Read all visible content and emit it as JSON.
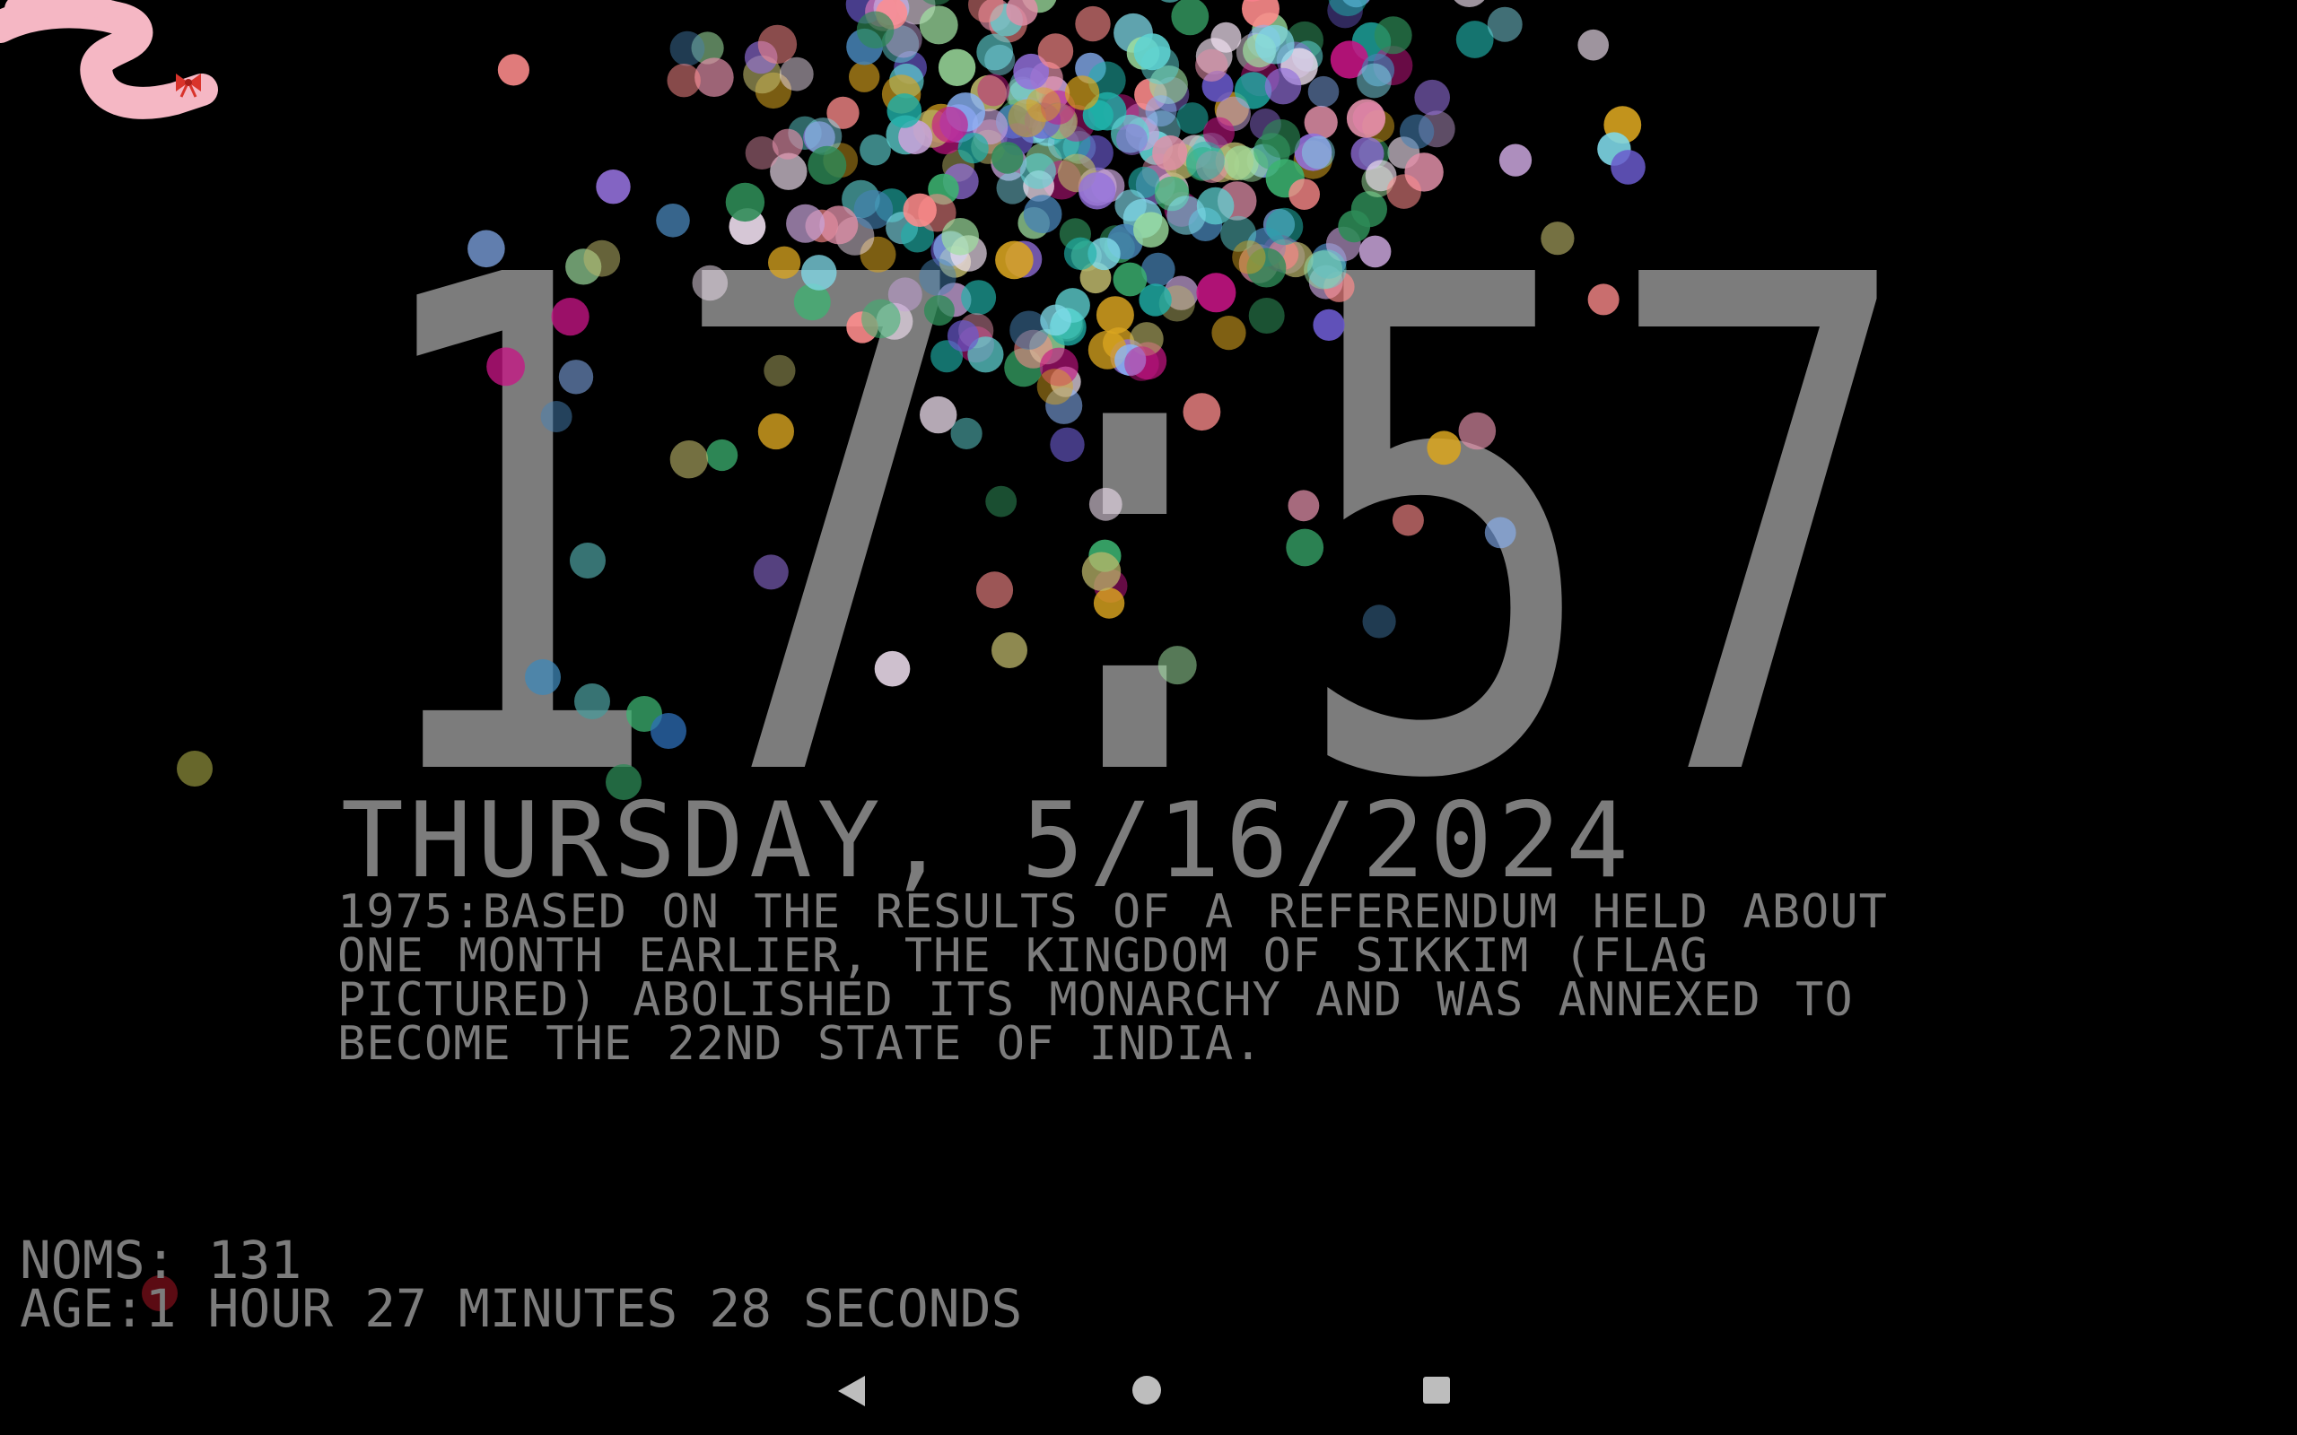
{
  "clock": {
    "time": "17:57"
  },
  "date": {
    "text": "THURSDAY, 5/16/2024"
  },
  "fact": {
    "text": "1975:BASED ON THE RESULTS OF A REFERENDUM HELD ABOUT ONE MONTH EARLIER, THE KINGDOM OF SIKKIM (FLAG PICTURED) ABOLISHED ITS MONARCHY AND WAS ANNEXED TO BECOME THE 22ND STATE OF INDIA."
  },
  "pet_stats": {
    "noms": "NOMS: 131",
    "age": "AGE:1 HOUR 27 MINUTES 28 SECONDS"
  },
  "colors": {
    "text": "#7c7c7c",
    "background": "#000000",
    "pet": "#f5b7c4",
    "bow": "#d9332b",
    "nav": "#bdbdbd"
  },
  "navbar": {
    "back_icon": "back-triangle-icon",
    "home_icon": "home-circle-icon",
    "recents_icon": "recents-square-icon"
  }
}
